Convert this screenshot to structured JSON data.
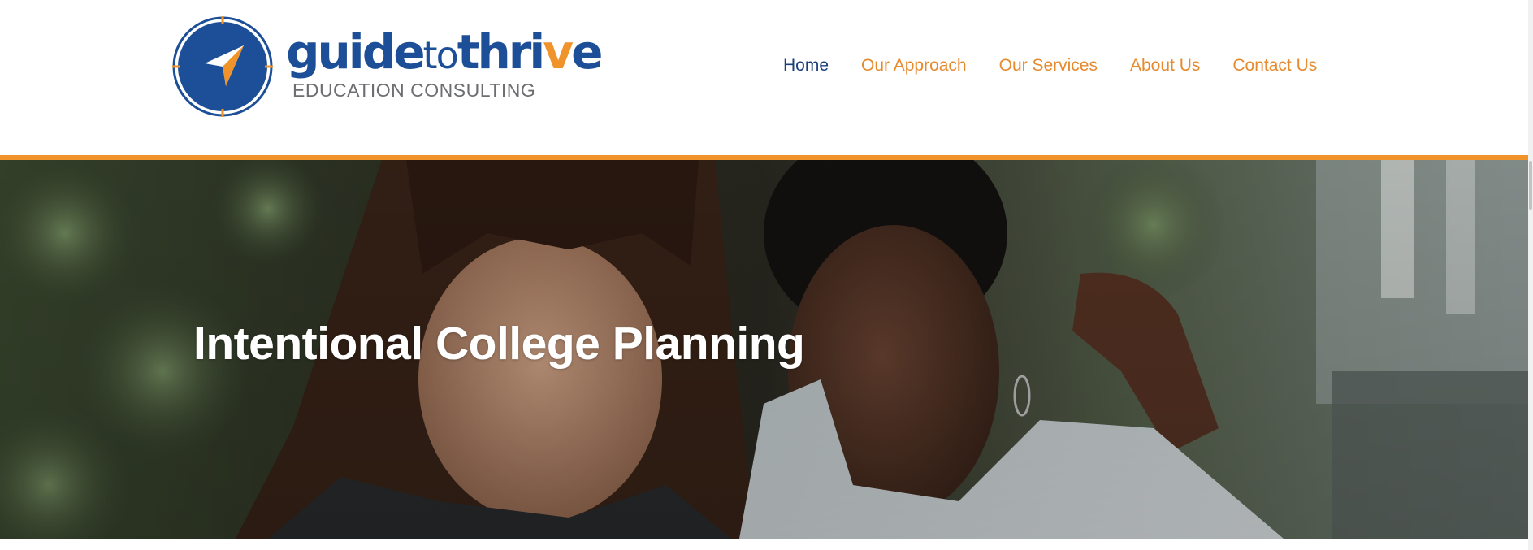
{
  "brand": {
    "word_part1": "guide",
    "word_part2": "to",
    "word_part3": "thri",
    "word_part4": "v",
    "word_part5": "e",
    "tagline": "EDUCATION CONSULTING"
  },
  "nav": {
    "items": [
      {
        "label": "Home",
        "active": true
      },
      {
        "label": "Our Approach",
        "active": false
      },
      {
        "label": "Our Services",
        "active": false
      },
      {
        "label": "About Us",
        "active": false
      },
      {
        "label": "Contact Us",
        "active": false
      }
    ]
  },
  "hero": {
    "title": "Intentional College Planning"
  },
  "colors": {
    "brand_blue": "#1c4f97",
    "nav_active": "#1c3f7a",
    "accent_orange": "#f0932b",
    "nav_orange": "#e68a2e"
  }
}
